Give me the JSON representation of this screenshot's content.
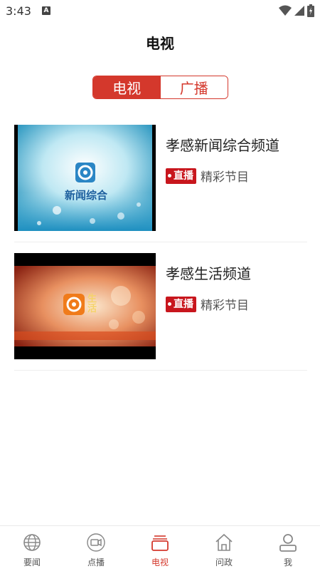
{
  "status_bar": {
    "time": "3:43",
    "notification_letter": "A"
  },
  "header": {
    "title": "电视"
  },
  "segments": [
    {
      "label": "电视",
      "active": true
    },
    {
      "label": "广播",
      "active": false
    }
  ],
  "channels": [
    {
      "name": "孝感新闻综合频道",
      "live_label": "直播",
      "program": "精彩节目",
      "logo_text": "新闻综合"
    },
    {
      "name": "孝感生活频道",
      "live_label": "直播",
      "program": "精彩节目",
      "logo_text": "生活"
    }
  ],
  "tabs": [
    {
      "label": "要闻",
      "icon": "globe-icon",
      "active": false
    },
    {
      "label": "点播",
      "icon": "video-camera-icon",
      "active": false
    },
    {
      "label": "电视",
      "icon": "tv-icon",
      "active": true
    },
    {
      "label": "问政",
      "icon": "home-icon",
      "active": false
    },
    {
      "label": "我",
      "icon": "person-icon",
      "active": false
    }
  ],
  "colors": {
    "accent": "#d4382c",
    "live_badge": "#c8161d",
    "inactive_tab": "#888888"
  }
}
